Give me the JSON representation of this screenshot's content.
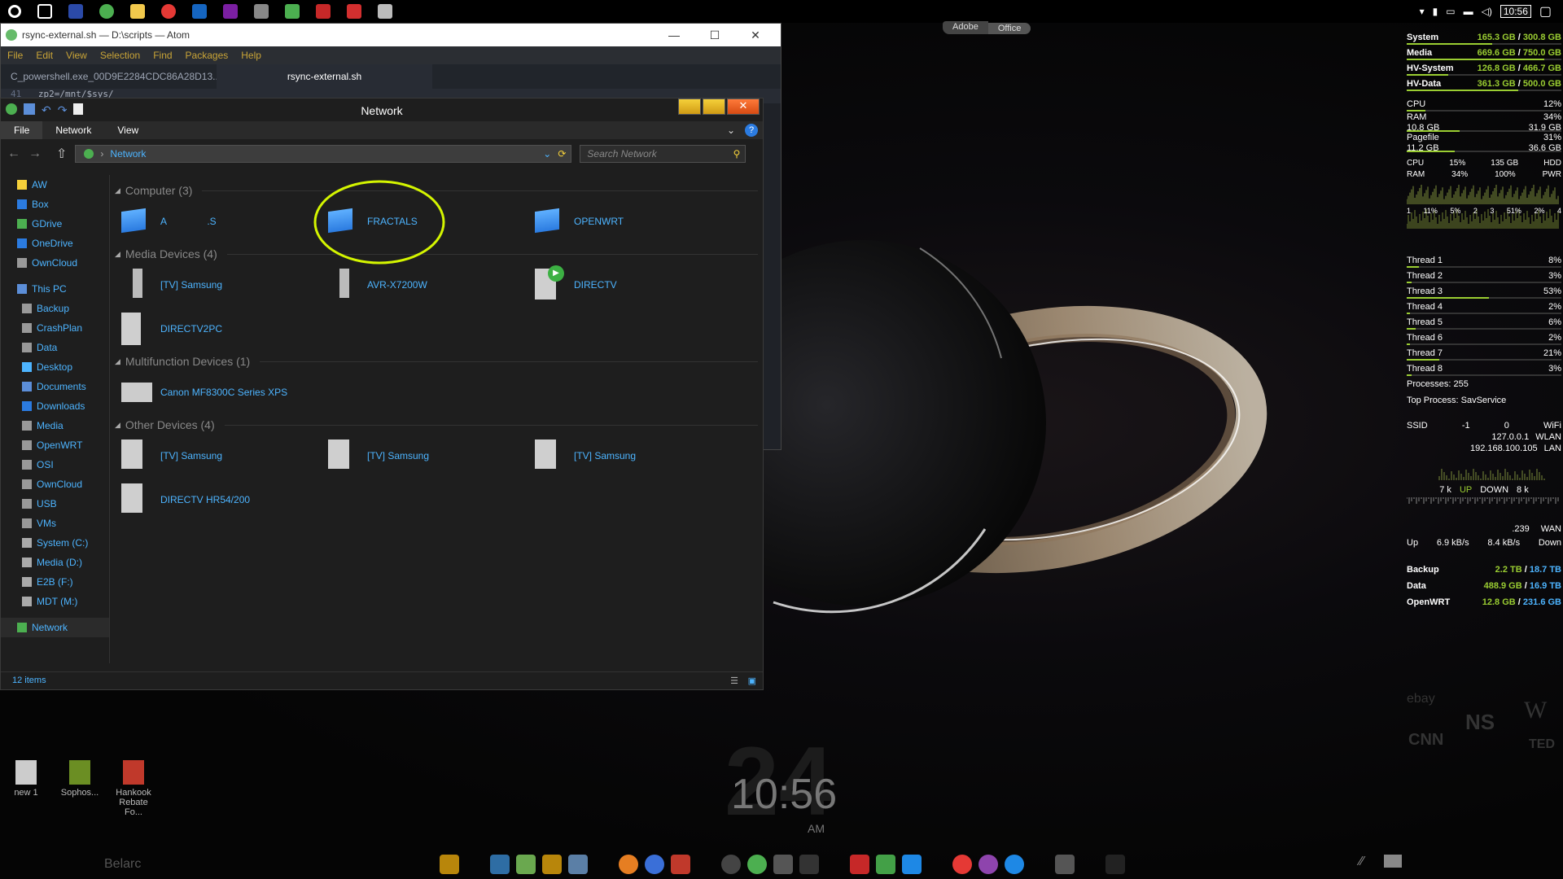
{
  "taskbar_top": {
    "icons": [
      "cortana-icon",
      "task-view-icon",
      "powershell-icon",
      "chrome-icon",
      "file-explorer-icon",
      "chrome-icon",
      "outlook-icon",
      "onenote-icon",
      "network-tool-icon",
      "network-tool-icon",
      "app-icon",
      "app-icon",
      "printer-icon"
    ],
    "time": "10:56"
  },
  "tabs_top_center": [
    "Adobe",
    "Office"
  ],
  "atom": {
    "title": "rsync-external.sh — D:\\scripts — Atom",
    "menu": [
      "File",
      "Edit",
      "View",
      "Selection",
      "Find",
      "Packages",
      "Help"
    ],
    "tabs": [
      "C_powershell.exe_00D9E2284CDC86A28D13...",
      "rsync-external.sh"
    ],
    "line_number": "41",
    "code_line": "zp2=/mnt/$sys/"
  },
  "explorer": {
    "title": "Network",
    "ribbon_tabs": [
      "File",
      "Network",
      "View"
    ],
    "address": "Network",
    "search_placeholder": "Search Network",
    "nav": [
      {
        "label": "AW",
        "icon": "star-icon"
      },
      {
        "label": "Box",
        "icon": "box-icon"
      },
      {
        "label": "GDrive",
        "icon": "gdrive-icon"
      },
      {
        "label": "OneDrive",
        "icon": "onedrive-icon"
      },
      {
        "label": "OwnCloud",
        "icon": "folder-icon"
      },
      {
        "label": "This PC",
        "icon": "pc-icon"
      },
      {
        "label": "Backup",
        "icon": "folder-icon"
      },
      {
        "label": "CrashPlan",
        "icon": "folder-icon"
      },
      {
        "label": "Data",
        "icon": "folder-icon"
      },
      {
        "label": "Desktop",
        "icon": "desktop-icon"
      },
      {
        "label": "Documents",
        "icon": "documents-icon"
      },
      {
        "label": "Downloads",
        "icon": "downloads-icon"
      },
      {
        "label": "Media",
        "icon": "folder-icon"
      },
      {
        "label": "OpenWRT",
        "icon": "folder-icon"
      },
      {
        "label": "OSI",
        "icon": "folder-icon"
      },
      {
        "label": "OwnCloud",
        "icon": "folder-icon"
      },
      {
        "label": "USB",
        "icon": "folder-icon"
      },
      {
        "label": "VMs",
        "icon": "folder-icon"
      },
      {
        "label": "System (C:)",
        "icon": "drive-icon"
      },
      {
        "label": "Media (D:)",
        "icon": "drive-icon"
      },
      {
        "label": "E2B (F:)",
        "icon": "drive-icon"
      },
      {
        "label": "MDT (M:)",
        "icon": "drive-icon"
      },
      {
        "label": "Network",
        "icon": "network-icon"
      }
    ],
    "groups": [
      {
        "title": "Computer (3)",
        "items": [
          {
            "label": "A               .S",
            "icon": "computer-icon"
          },
          {
            "label": "FRACTALS",
            "icon": "computer-icon"
          },
          {
            "label": "OPENWRT",
            "icon": "computer-icon"
          }
        ]
      },
      {
        "title": "Media Devices (4)",
        "items": [
          {
            "label": "[TV] Samsung",
            "icon": "media-device-icon"
          },
          {
            "label": "AVR-X7200W",
            "icon": "media-device-icon"
          },
          {
            "label": "DIRECTV",
            "icon": "media-player-icon"
          },
          {
            "label": "DIRECTV2PC",
            "icon": "media-server-icon"
          }
        ]
      },
      {
        "title": "Multifunction Devices (1)",
        "items": [
          {
            "label": "Canon MF8300C Series XPS",
            "icon": "printer-icon"
          }
        ]
      },
      {
        "title": "Other Devices (4)",
        "items": [
          {
            "label": "[TV] Samsung",
            "icon": "device-icon"
          },
          {
            "label": "[TV] Samsung",
            "icon": "device-icon"
          },
          {
            "label": "[TV] Samsung",
            "icon": "device-icon"
          },
          {
            "label": "DIRECTV HR54/200",
            "icon": "device-icon"
          }
        ]
      }
    ],
    "status": "12 items"
  },
  "rainmeter": {
    "drives": [
      {
        "name": "System",
        "used": "165.3 GB",
        "total": "300.8 GB",
        "used_fraction": 0.55
      },
      {
        "name": "Media",
        "used": "669.6 GB",
        "total": "750.0 GB",
        "used_fraction": 0.89
      },
      {
        "name": "HV-System",
        "used": "126.8 GB",
        "total": "466.7 GB",
        "used_fraction": 0.27
      },
      {
        "name": "HV-Data",
        "used": "361.3 GB",
        "total": "500.0 GB",
        "used_fraction": 0.72
      }
    ],
    "cpu": {
      "label": "CPU",
      "value": "12%",
      "fraction": 0.12
    },
    "ram": {
      "label": "RAM",
      "value": "34%",
      "used": "10.8 GB",
      "total": "31.9 GB",
      "fraction": 0.34
    },
    "pagefile": {
      "label": "Pagefile",
      "value": "31%",
      "used": "11.2 GB",
      "total": "36.6 GB",
      "fraction": 0.31
    },
    "hdd_row1": [
      "CPU",
      "15%",
      "135 GB",
      "HDD"
    ],
    "hdd_row2": [
      "RAM",
      "34%",
      "100%",
      "PWR"
    ],
    "graph_labels": [
      "1",
      "11%",
      "5%",
      "2",
      "3",
      "51%",
      "2%",
      "4"
    ],
    "threads": [
      {
        "name": "Thread 1",
        "value": "8%",
        "fraction": 0.08
      },
      {
        "name": "Thread 2",
        "value": "3%",
        "fraction": 0.03
      },
      {
        "name": "Thread 3",
        "value": "53%",
        "fraction": 0.53
      },
      {
        "name": "Thread 4",
        "value": "2%",
        "fraction": 0.02
      },
      {
        "name": "Thread 5",
        "value": "6%",
        "fraction": 0.06
      },
      {
        "name": "Thread 6",
        "value": "2%",
        "fraction": 0.02
      },
      {
        "name": "Thread 7",
        "value": "21%",
        "fraction": 0.21
      },
      {
        "name": "Thread 8",
        "value": "3%",
        "fraction": 0.03
      }
    ],
    "processes": "Processes: 255",
    "top_process": "Top Process: SavService",
    "net": {
      "ssid_label": "SSID",
      "ssid_value": "-1",
      "wifi_value": "0",
      "wifi_label": "WiFi",
      "wlan_ip": "127.0.0.1",
      "wlan_label": "WLAN",
      "lan_ip": "192.168.100.105",
      "lan_label": "LAN",
      "up_k": "7 k",
      "up_label": "UP",
      "down_label": "DOWN",
      "down_k": "8 k",
      "wan_ip": ".239",
      "wan_label": "WAN",
      "up_word": "Up",
      "up_rate": "6.9 kB/s",
      "down_rate": "8.4 kB/s",
      "down_word": "Down"
    },
    "backup_drives": [
      {
        "name": "Backup",
        "used": "2.2 TB",
        "total": "18.7 TB"
      },
      {
        "name": "Data",
        "used": "488.9 GB",
        "total": "16.9 TB"
      },
      {
        "name": "OpenWRT",
        "used": "12.8 GB",
        "total": "231.6 GB"
      }
    ],
    "logos": [
      "ebay",
      "NS",
      "W",
      "CNN",
      "TED"
    ]
  },
  "desktop_icons": [
    {
      "label": "new 1"
    },
    {
      "label": "Sophos..."
    },
    {
      "label": "Hankook Rebate Fo..."
    }
  ],
  "desktop_clock": {
    "time": "10:56",
    "ampm": "AM",
    "big_date": "24"
  },
  "belarc": "Belarc",
  "colors": {
    "accent_blue": "#4db4ff",
    "rainmeter_green": "#9acd32",
    "highlight_circle": "#d4f500"
  }
}
